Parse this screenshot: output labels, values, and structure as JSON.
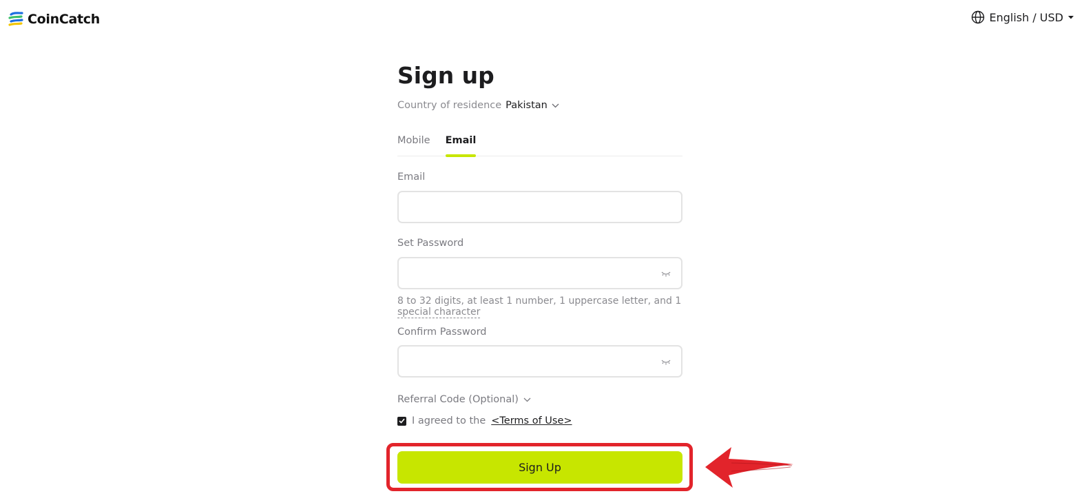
{
  "brand": {
    "name": "CoinCatch",
    "colors": {
      "accent": "#c7e600",
      "annotation": "#e2242b",
      "logo_blue": "#1d6fe0",
      "logo_green": "#3cc06a",
      "logo_yellow": "#f2c500"
    }
  },
  "header": {
    "language_label": "English / USD",
    "icons": [
      "globe-icon",
      "caret-down-icon"
    ]
  },
  "signup": {
    "title": "Sign up",
    "country_label": "Country of residence",
    "country_value": "Pakistan",
    "tabs": [
      {
        "label": "Mobile",
        "active": false
      },
      {
        "label": "Email",
        "active": true
      }
    ],
    "email_label": "Email",
    "email_value": "",
    "password_label": "Set Password",
    "password_value": "",
    "password_hint_part1": "8 to 32 digits, at least 1 number, 1 uppercase letter, and 1",
    "password_hint_part2": "special character",
    "confirm_label": "Confirm Password",
    "confirm_value": "",
    "referral_label": "Referral Code (Optional)",
    "agree_text": "I agreed to the",
    "terms_link": "<Terms of Use>",
    "agree_checked": true,
    "submit_label": "Sign Up"
  },
  "annotations": {
    "highlight": "red box around Sign Up button",
    "arrow_icon": "red-arrow-left-icon"
  }
}
